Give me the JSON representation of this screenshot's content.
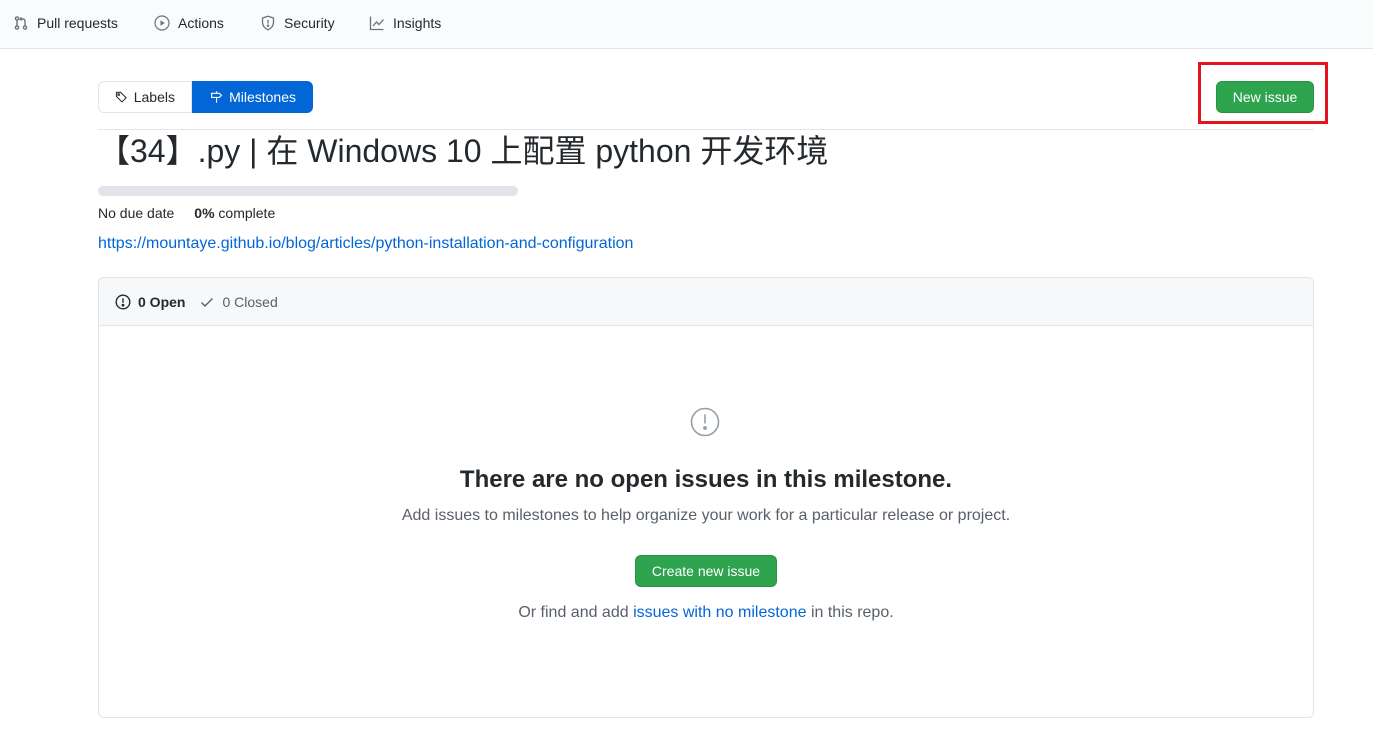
{
  "repo_nav": {
    "items": [
      {
        "label": "Pull requests",
        "icon": "git-pull-request-icon"
      },
      {
        "label": "Actions",
        "icon": "play-icon"
      },
      {
        "label": "Security",
        "icon": "shield-icon"
      },
      {
        "label": "Insights",
        "icon": "graph-icon"
      }
    ]
  },
  "subnav": {
    "labels": "Labels",
    "milestones": "Milestones"
  },
  "new_issue_button": "New issue",
  "milestone": {
    "title": "【34】.py | 在 Windows 10 上配置 python 开发环境",
    "progress_percent": 0,
    "due": "No due date",
    "percent_label": "0%",
    "complete_label": "complete",
    "description_link": "https://mountaye.github.io/blog/articles/python-installation-and-configuration"
  },
  "issues": {
    "open_count": "0 Open",
    "closed_count": "0 Closed",
    "blank_title": "There are no open issues in this milestone.",
    "blank_sub": "Add issues to milestones to help organize your work for a particular release or project.",
    "create_button": "Create new issue",
    "foot_prefix": "Or find and add",
    "foot_link": "issues with no milestone",
    "foot_suffix": "in this repo."
  },
  "colors": {
    "accent_blue": "#0366d6",
    "green": "#2ea44f",
    "highlight_red": "#e3141f"
  }
}
